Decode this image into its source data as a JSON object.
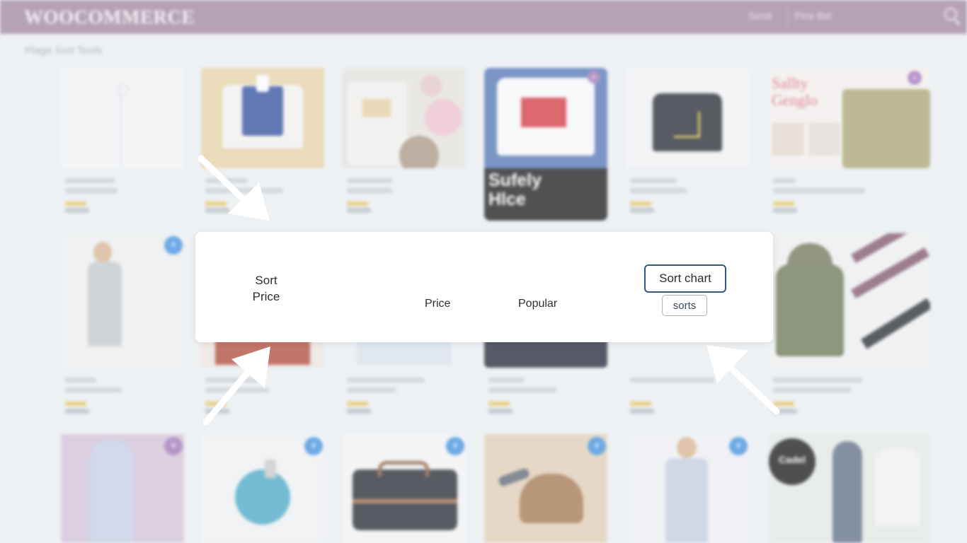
{
  "header": {
    "logo": "WOOCOMMERCE",
    "nav": [
      "Send",
      "Fine Bel"
    ],
    "search_icon": "search-icon"
  },
  "breadcrumb": "Plage Sort Tools",
  "sort_panel": {
    "title": "Sort Price",
    "options": [
      "Price",
      "Popular"
    ],
    "sort_chart_button": "Sort chart",
    "sorts_button": "sorts"
  },
  "products_row1_overlay": {
    "tshirt_banner_line1": "Sufely",
    "tshirt_banner_line2": "Hlce",
    "poster_title_line1": "Sallty",
    "poster_title_line2": "Genglo"
  },
  "products_row3_badge": "Cadel"
}
